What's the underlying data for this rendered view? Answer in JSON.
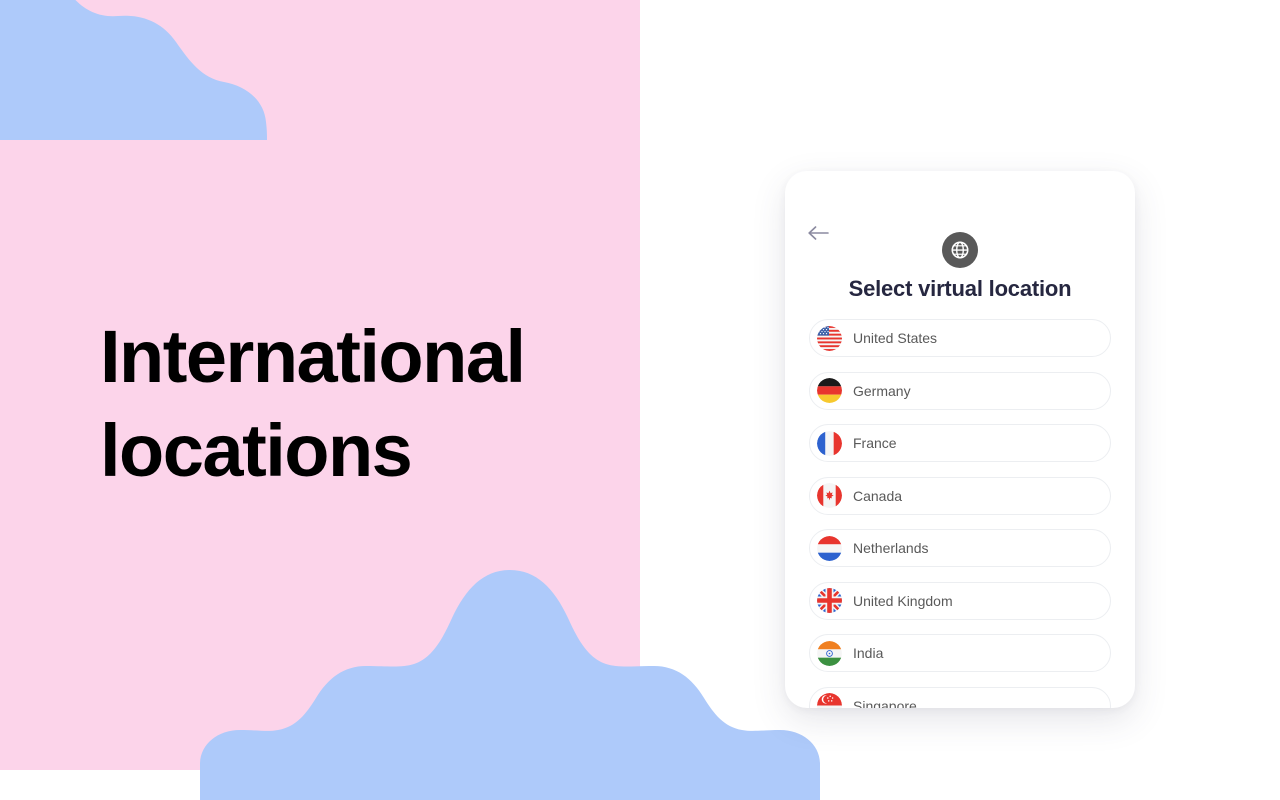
{
  "theme": {
    "pink_background": "#fcd4ea",
    "cloud_blue": "#aecafa",
    "panel_white": "#ffffff",
    "headline_color": "#000000",
    "card_title_color": "#262740",
    "row_label_color": "#595959",
    "globe_badge_color": "#595959",
    "row_border_color": "#eceef1",
    "back_arrow_color": "#8b8aa0"
  },
  "hero": {
    "headline": "International\nlocations"
  },
  "decor": {
    "cloud_top_left": "cloud-shape",
    "cloud_bottom_center": "cloud-shape"
  },
  "card": {
    "back_button_label": "Back",
    "back_icon": "arrow-left-icon",
    "badge_icon": "globe-icon",
    "title": "Select virtual location",
    "locations": [
      {
        "name": "United States",
        "flag": "flag-us"
      },
      {
        "name": "Germany",
        "flag": "flag-de"
      },
      {
        "name": "France",
        "flag": "flag-fr"
      },
      {
        "name": "Canada",
        "flag": "flag-ca"
      },
      {
        "name": "Netherlands",
        "flag": "flag-nl"
      },
      {
        "name": "United Kingdom",
        "flag": "flag-gb"
      },
      {
        "name": "India",
        "flag": "flag-in"
      },
      {
        "name": "Singapore",
        "flag": "flag-sg"
      }
    ]
  }
}
